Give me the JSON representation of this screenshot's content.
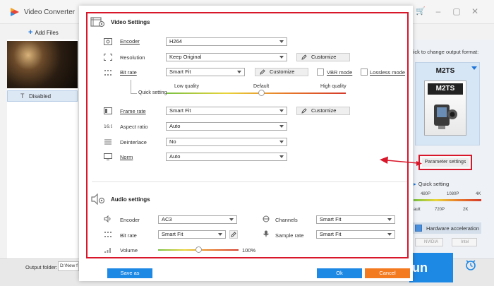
{
  "app": {
    "title": "Video Converter",
    "add_files_label": "Add Files",
    "track_label": "Disabled",
    "output_folder_label": "Output folder:",
    "output_folder_value": "D:\\New f",
    "run_label": "un",
    "right_panel": {
      "hint": "lick to change output format:",
      "format_name": "M2TS",
      "format_box_label": "M2TS",
      "parameter_settings_label": "Parameter settings",
      "quick_setting_label": "Quick setting",
      "top_ticks": [
        "480P",
        "1080P",
        "4K"
      ],
      "bottom_ticks": [
        "ault",
        "720P",
        "2K"
      ],
      "hw_accel_label": "Hardware acceleration",
      "vendors": [
        "NVIDIA",
        "Intel"
      ]
    }
  },
  "dialog": {
    "video_title": "Video Settings",
    "audio_title": "Audio settings",
    "video": {
      "encoder": {
        "label": "Encoder",
        "value": "H264"
      },
      "resolution": {
        "label": "Resolution",
        "value": "Keep Original",
        "button": "Customize"
      },
      "bitrate": {
        "label": "Bit rate",
        "value": "Smart Fit",
        "button": "Customize",
        "vbr": "VBR mode",
        "lossless": "Lossless mode"
      },
      "quick_setting": {
        "label": "Quick setting",
        "low": "Low quality",
        "default": "Default",
        "high": "High quality",
        "position": 0.53
      },
      "framerate": {
        "label": "Frame rate",
        "value": "Smart Fit",
        "button": "Customize"
      },
      "aspect": {
        "label": "Aspect ratio",
        "value": "Auto"
      },
      "deinterlace": {
        "label": "Deinterlace",
        "value": "No"
      },
      "norm": {
        "label": "Norm",
        "value": "Auto"
      }
    },
    "audio": {
      "encoder": {
        "label": "Encoder",
        "value": "AC3"
      },
      "channels": {
        "label": "Channels",
        "value": "Smart Fit"
      },
      "bitrate": {
        "label": "Bit rate",
        "value": "Smart Fit"
      },
      "samplerate": {
        "label": "Sample rate",
        "value": "Smart Fit"
      },
      "volume": {
        "label": "Volume",
        "value": "100%",
        "position": 0.5
      }
    },
    "footer": {
      "save_as": "Save as",
      "ok": "Ok",
      "cancel": "Cancel"
    }
  },
  "colors": {
    "accent_blue": "#1e88e5",
    "cancel_orange": "#f47a20",
    "highlight_red": "#d8172a"
  }
}
